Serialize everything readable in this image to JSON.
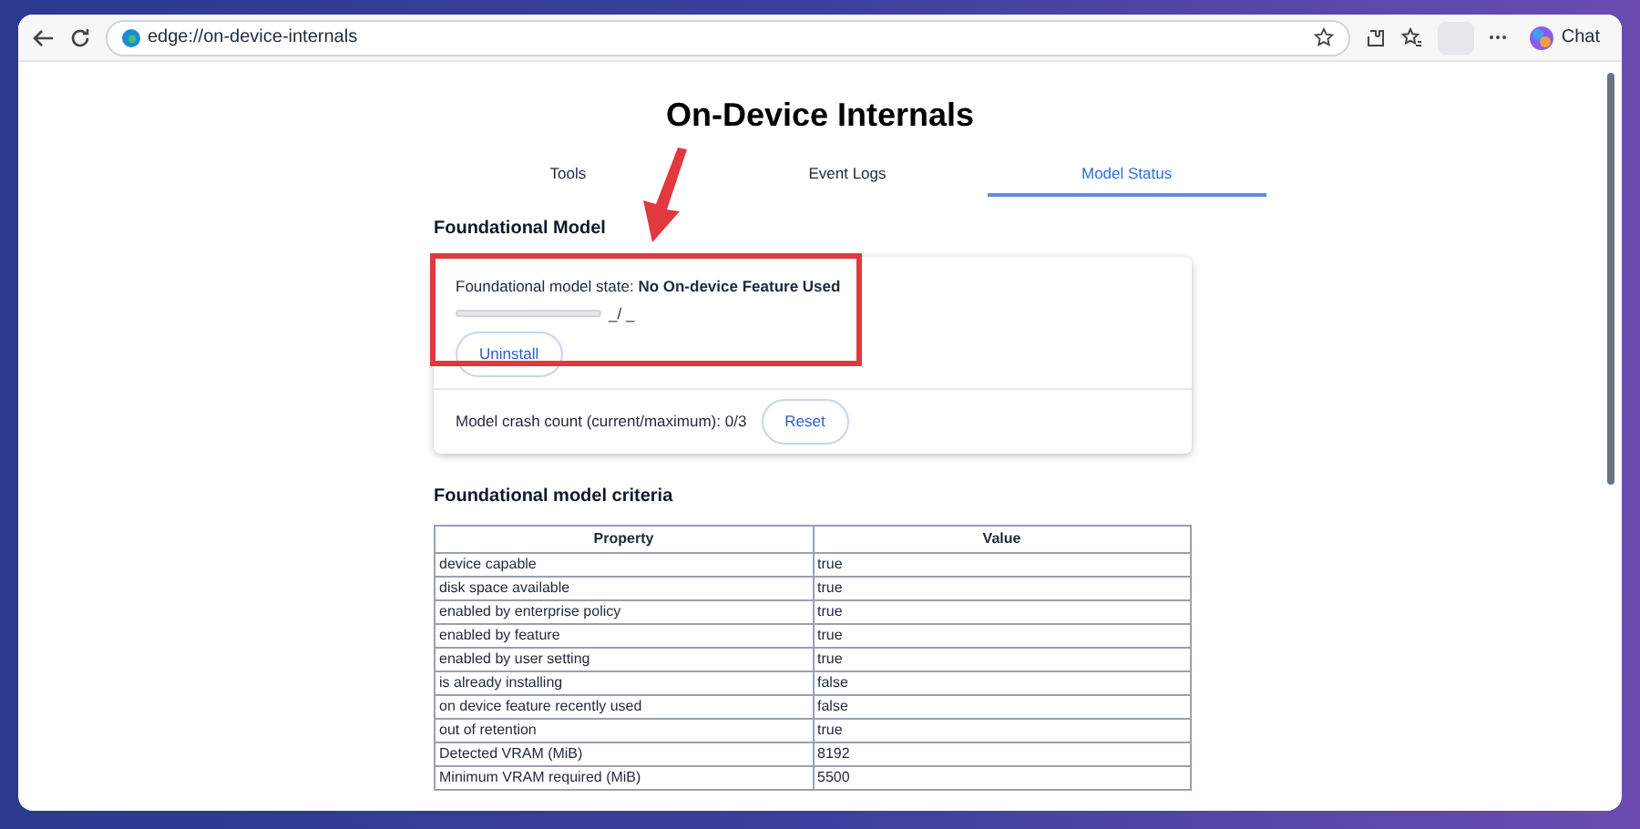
{
  "browser": {
    "address": "edge://on-device-internals",
    "chat_label": "Chat"
  },
  "page": {
    "title": "On-Device Internals",
    "tabs": [
      {
        "label": "Tools",
        "selected": false
      },
      {
        "label": "Event Logs",
        "selected": false
      },
      {
        "label": "Model Status",
        "selected": true
      }
    ],
    "section_title": "Foundational Model",
    "state_label": "Foundational model state: ",
    "state_value": "No On-device Feature Used",
    "progress": {
      "level": 0,
      "reading": "_/ _"
    },
    "uninstall_button": "Uninstall",
    "crash_count": "Model crash count (current/maximum): 0/3",
    "reset_button": "Reset",
    "criteria_title": "Foundational model criteria",
    "table": {
      "columns": [
        "Property",
        "Value"
      ],
      "rows": [
        [
          "device capable",
          "true"
        ],
        [
          "disk space available",
          "true"
        ],
        [
          "enabled by enterprise policy",
          "true"
        ],
        [
          "enabled by feature",
          "true"
        ],
        [
          "enabled by user setting",
          "true"
        ],
        [
          "is already installing",
          "false"
        ],
        [
          "on device feature recently used",
          "false"
        ],
        [
          "out of retention",
          "true"
        ],
        [
          "Detected VRAM (MiB)",
          "8192"
        ],
        [
          "Minimum VRAM required (MiB)",
          "5500"
        ]
      ]
    }
  }
}
